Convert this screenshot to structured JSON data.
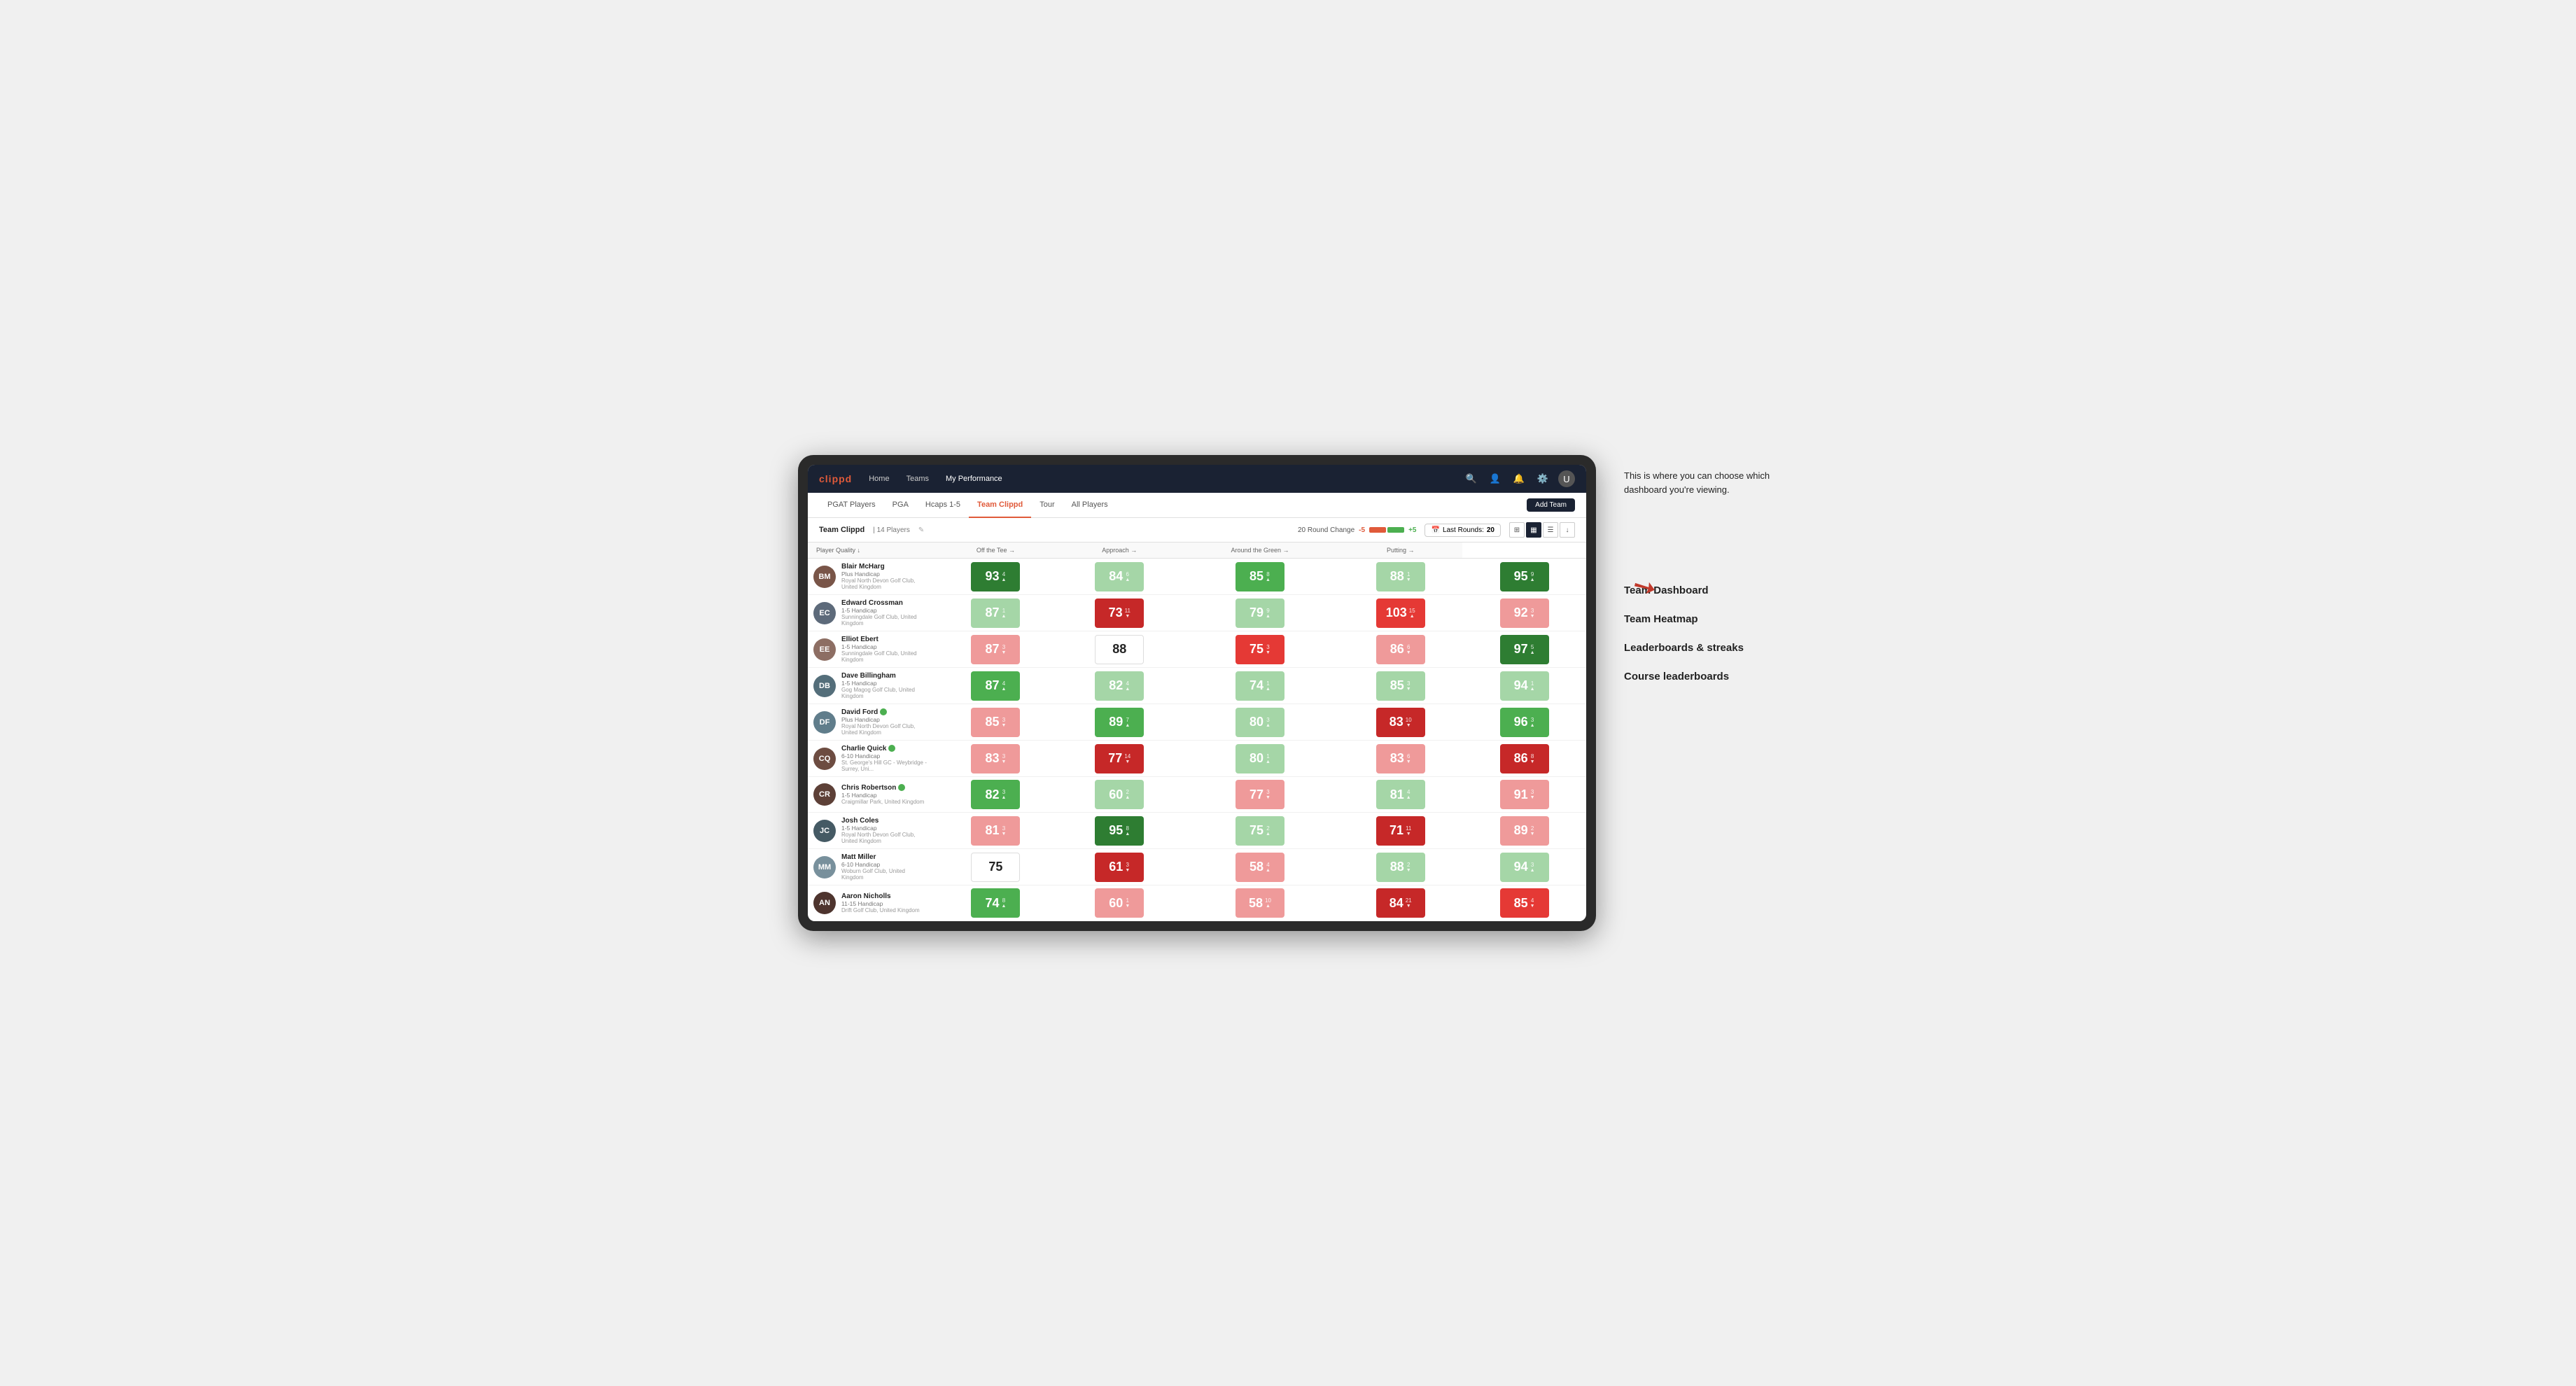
{
  "nav": {
    "logo": "clippd",
    "links": [
      "Home",
      "Teams",
      "My Performance"
    ],
    "active_link": "My Performance"
  },
  "sub_nav": {
    "tabs": [
      "PGAT Players",
      "PGA",
      "Hcaps 1-5",
      "Team Clippd",
      "Tour",
      "All Players"
    ],
    "active_tab": "Team Clippd",
    "add_team_label": "Add Team"
  },
  "team_bar": {
    "name": "Team Clippd",
    "separator": "|",
    "count": "14 Players",
    "round_change_label": "20 Round Change",
    "change_neg": "-5",
    "change_pos": "+5",
    "last_rounds_label": "Last Rounds:",
    "last_rounds_value": "20"
  },
  "table": {
    "columns": [
      "Player Quality ↓",
      "Off the Tee →",
      "Approach →",
      "Around the Green →",
      "Putting →"
    ],
    "player_col_label": "Player",
    "rows": [
      {
        "name": "Blair McHarg",
        "hcap": "Plus Handicap",
        "club": "Royal North Devon Golf Club, United Kingdom",
        "initials": "BM",
        "avatar_color": "#795548",
        "scores": [
          {
            "value": "93",
            "change": "4",
            "dir": "up",
            "color": "green-dark"
          },
          {
            "value": "84",
            "change": "6",
            "dir": "up",
            "color": "green-light"
          },
          {
            "value": "85",
            "change": "8",
            "dir": "up",
            "color": "green-med"
          },
          {
            "value": "88",
            "change": "1",
            "dir": "down",
            "color": "green-light"
          },
          {
            "value": "95",
            "change": "9",
            "dir": "up",
            "color": "green-dark"
          }
        ]
      },
      {
        "name": "Edward Crossman",
        "hcap": "1-5 Handicap",
        "club": "Sunningdale Golf Club, United Kingdom",
        "initials": "EC",
        "avatar_color": "#5d6a7a",
        "scores": [
          {
            "value": "87",
            "change": "1",
            "dir": "up",
            "color": "green-light"
          },
          {
            "value": "73",
            "change": "11",
            "dir": "down",
            "color": "red-dark"
          },
          {
            "value": "79",
            "change": "9",
            "dir": "up",
            "color": "green-light"
          },
          {
            "value": "103",
            "change": "15",
            "dir": "up",
            "color": "red-med"
          },
          {
            "value": "92",
            "change": "3",
            "dir": "down",
            "color": "red-light"
          }
        ]
      },
      {
        "name": "Elliot Ebert",
        "hcap": "1-5 Handicap",
        "club": "Sunningdale Golf Club, United Kingdom",
        "initials": "EE",
        "avatar_color": "#8d6e63",
        "scores": [
          {
            "value": "87",
            "change": "3",
            "dir": "down",
            "color": "red-light"
          },
          {
            "value": "88",
            "change": "",
            "dir": "",
            "color": "white"
          },
          {
            "value": "75",
            "change": "3",
            "dir": "down",
            "color": "red-med"
          },
          {
            "value": "86",
            "change": "6",
            "dir": "down",
            "color": "red-light"
          },
          {
            "value": "97",
            "change": "5",
            "dir": "up",
            "color": "green-dark"
          }
        ]
      },
      {
        "name": "Dave Billingham",
        "hcap": "1-5 Handicap",
        "club": "Gog Magog Golf Club, United Kingdom",
        "initials": "DB",
        "avatar_color": "#546e7a",
        "scores": [
          {
            "value": "87",
            "change": "4",
            "dir": "up",
            "color": "green-med"
          },
          {
            "value": "82",
            "change": "4",
            "dir": "up",
            "color": "green-light"
          },
          {
            "value": "74",
            "change": "1",
            "dir": "up",
            "color": "green-light"
          },
          {
            "value": "85",
            "change": "3",
            "dir": "down",
            "color": "green-light"
          },
          {
            "value": "94",
            "change": "1",
            "dir": "up",
            "color": "green-light"
          }
        ]
      },
      {
        "name": "David Ford",
        "hcap": "Plus Handicap",
        "club": "Royal North Devon Golf Club, United Kingdom",
        "initials": "DF",
        "avatar_color": "#607d8b",
        "verified": true,
        "scores": [
          {
            "value": "85",
            "change": "3",
            "dir": "down",
            "color": "red-light"
          },
          {
            "value": "89",
            "change": "7",
            "dir": "up",
            "color": "green-med"
          },
          {
            "value": "80",
            "change": "3",
            "dir": "up",
            "color": "green-light"
          },
          {
            "value": "83",
            "change": "10",
            "dir": "down",
            "color": "red-dark"
          },
          {
            "value": "96",
            "change": "3",
            "dir": "up",
            "color": "green-med"
          }
        ]
      },
      {
        "name": "Charlie Quick",
        "hcap": "6-10 Handicap",
        "club": "St. George's Hill GC - Weybridge - Surrey, Uni...",
        "initials": "CQ",
        "avatar_color": "#6d4c41",
        "verified": true,
        "scores": [
          {
            "value": "83",
            "change": "3",
            "dir": "down",
            "color": "red-light"
          },
          {
            "value": "77",
            "change": "14",
            "dir": "down",
            "color": "red-dark"
          },
          {
            "value": "80",
            "change": "1",
            "dir": "up",
            "color": "green-light"
          },
          {
            "value": "83",
            "change": "6",
            "dir": "down",
            "color": "red-light"
          },
          {
            "value": "86",
            "change": "8",
            "dir": "down",
            "color": "red-dark"
          }
        ]
      },
      {
        "name": "Chris Robertson",
        "hcap": "1-5 Handicap",
        "club": "Craigmillar Park, United Kingdom",
        "initials": "CR",
        "avatar_color": "#5d4037",
        "verified": true,
        "scores": [
          {
            "value": "82",
            "change": "3",
            "dir": "up",
            "color": "green-med"
          },
          {
            "value": "60",
            "change": "2",
            "dir": "up",
            "color": "green-light"
          },
          {
            "value": "77",
            "change": "3",
            "dir": "down",
            "color": "red-light"
          },
          {
            "value": "81",
            "change": "4",
            "dir": "up",
            "color": "green-light"
          },
          {
            "value": "91",
            "change": "3",
            "dir": "down",
            "color": "red-light"
          }
        ]
      },
      {
        "name": "Josh Coles",
        "hcap": "1-5 Handicap",
        "club": "Royal North Devon Golf Club, United Kingdom",
        "initials": "JC",
        "avatar_color": "#455a64",
        "scores": [
          {
            "value": "81",
            "change": "3",
            "dir": "down",
            "color": "red-light"
          },
          {
            "value": "95",
            "change": "8",
            "dir": "up",
            "color": "green-dark"
          },
          {
            "value": "75",
            "change": "2",
            "dir": "up",
            "color": "green-light"
          },
          {
            "value": "71",
            "change": "11",
            "dir": "down",
            "color": "red-dark"
          },
          {
            "value": "89",
            "change": "2",
            "dir": "down",
            "color": "red-light"
          }
        ]
      },
      {
        "name": "Matt Miller",
        "hcap": "6-10 Handicap",
        "club": "Woburn Golf Club, United Kingdom",
        "initials": "MM",
        "avatar_color": "#78909c",
        "scores": [
          {
            "value": "75",
            "change": "",
            "dir": "",
            "color": "white"
          },
          {
            "value": "61",
            "change": "3",
            "dir": "down",
            "color": "red-dark"
          },
          {
            "value": "58",
            "change": "4",
            "dir": "up",
            "color": "red-light"
          },
          {
            "value": "88",
            "change": "2",
            "dir": "down",
            "color": "green-light"
          },
          {
            "value": "94",
            "change": "3",
            "dir": "up",
            "color": "green-light"
          }
        ]
      },
      {
        "name": "Aaron Nicholls",
        "hcap": "11-15 Handicap",
        "club": "Drift Golf Club, United Kingdom",
        "initials": "AN",
        "avatar_color": "#4e342e",
        "scores": [
          {
            "value": "74",
            "change": "8",
            "dir": "up",
            "color": "green-med"
          },
          {
            "value": "60",
            "change": "1",
            "dir": "down",
            "color": "red-light"
          },
          {
            "value": "58",
            "change": "10",
            "dir": "up",
            "color": "red-light"
          },
          {
            "value": "84",
            "change": "21",
            "dir": "down",
            "color": "red-dark"
          },
          {
            "value": "85",
            "change": "4",
            "dir": "down",
            "color": "red-med"
          }
        ]
      }
    ]
  },
  "annotation": {
    "callout": "This is where you can choose which dashboard you're viewing.",
    "items": [
      "Team Dashboard",
      "Team Heatmap",
      "Leaderboards & streaks",
      "Course leaderboards"
    ]
  }
}
